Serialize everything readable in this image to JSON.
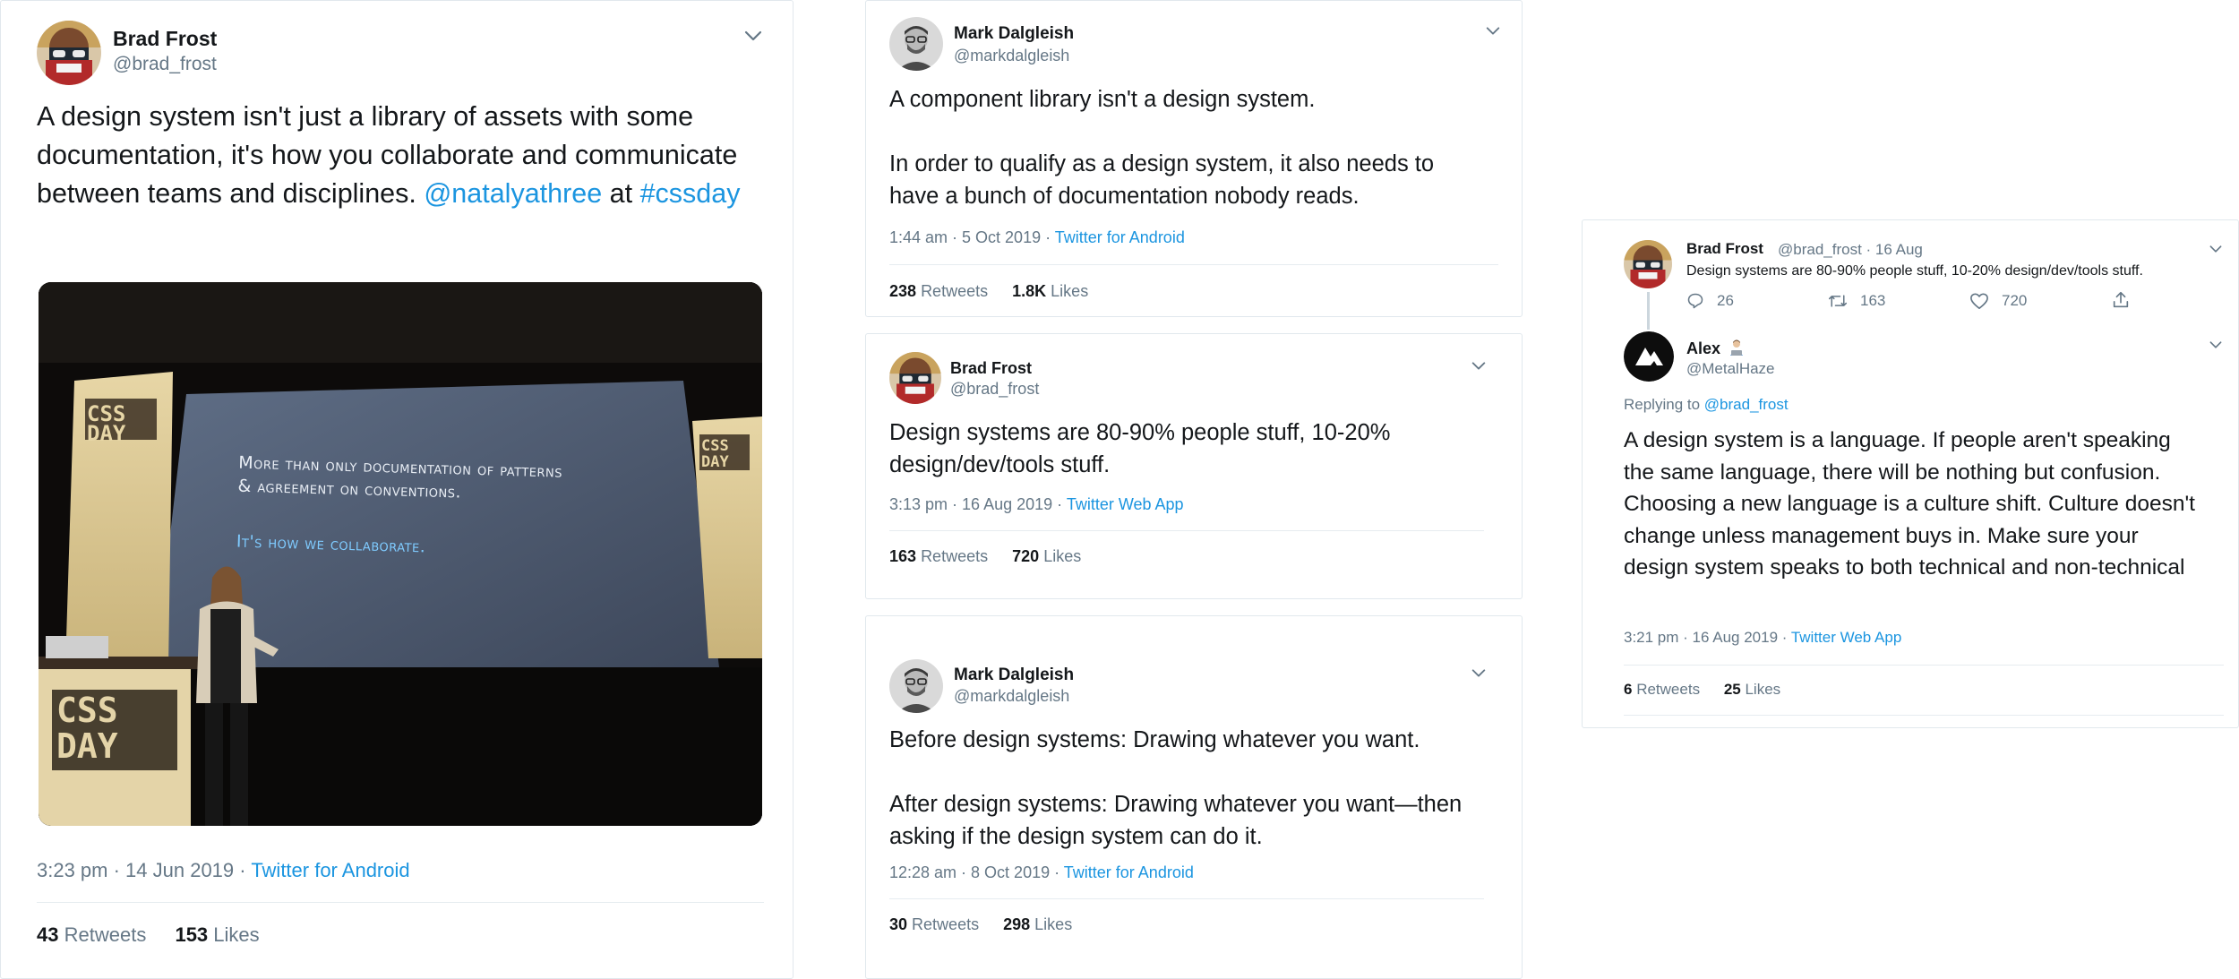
{
  "tweets": [
    {
      "name": "Brad Frost",
      "handle": "@brad_frost",
      "text_plain": "A design system isn't just a library of assets with some documentation, it's how you collaborate and communicate between teams and disciplines.",
      "mention": "@natalyathree",
      "connector": "at",
      "hashtag": "#cssday",
      "image": {
        "screen_line1": "More than only documentation of patterns",
        "screen_line2": "& agreement on conventions.",
        "screen_line3": "It's how we collaborate.",
        "banner_text": "CSS DAY"
      },
      "timestamp": "3:23 pm · 14 Jun 2019 · ",
      "source": "Twitter for Android",
      "retweets_count": "43",
      "retweets_label": "Retweets",
      "likes_count": "153",
      "likes_label": "Likes"
    },
    {
      "name": "Mark Dalgleish",
      "handle": "@markdalgleish",
      "text_line1": "A component library isn't a design system.",
      "text_line2": "In order to qualify as a design system, it also needs to have a bunch of documentation nobody reads.",
      "timestamp": "1:44 am · 5 Oct 2019 · ",
      "source": "Twitter for Android",
      "retweets_count": "238",
      "retweets_label": "Retweets",
      "likes_count": "1.8K",
      "likes_label": "Likes"
    },
    {
      "name": "Brad Frost",
      "handle": "@brad_frost",
      "text_line1": "Design systems are 80-90% people stuff, 10-20% design/dev/tools stuff.",
      "timestamp": "3:13 pm · 16 Aug 2019 · ",
      "source": "Twitter Web App",
      "retweets_count": "163",
      "retweets_label": "Retweets",
      "likes_count": "720",
      "likes_label": "Likes"
    },
    {
      "name": "Mark Dalgleish",
      "handle": "@markdalgleish",
      "text_line1": "Before design systems: Drawing whatever you want.",
      "text_line2": "After design systems: Drawing whatever you want—then asking if the design system can do it.",
      "timestamp": "12:28 am · 8 Oct 2019 · ",
      "source": "Twitter for Android",
      "retweets_count": "30",
      "retweets_label": "Retweets",
      "likes_count": "298",
      "likes_label": "Likes"
    },
    {
      "parent": {
        "name": "Brad Frost",
        "handle_date": "@brad_frost · 16 Aug",
        "text": "Design systems are 80-90% people stuff, 10-20% design/dev/tools stuff.",
        "replies": "26",
        "retweets": "163",
        "likes": "720"
      },
      "reply": {
        "name": "Alex",
        "handle": "@MetalHaze",
        "replying_to_label": "Replying to ",
        "replying_to_handle": "@brad_frost",
        "text": "A design system is a language. If people aren't speaking the same language, there will be nothing but confusion. Choosing a new language is a culture shift. Culture doesn't change unless management buys in. Make sure your design system speaks to both technical and non-technical",
        "timestamp": "3:21 pm · 16 Aug 2019 · ",
        "source": "Twitter Web App",
        "retweets_count": "6",
        "retweets_label": "Retweets",
        "likes_count": "25",
        "likes_label": "Likes"
      }
    }
  ],
  "icons": {
    "chevron": "chevron-down-icon",
    "reply": "reply-icon",
    "retweet": "retweet-icon",
    "like": "heart-icon",
    "share": "share-icon",
    "alex_emoji": "technologist-emoji-icon"
  },
  "colors": {
    "link": "#1b95e0",
    "secondary_text": "#657786",
    "border": "#e1e8ed"
  }
}
